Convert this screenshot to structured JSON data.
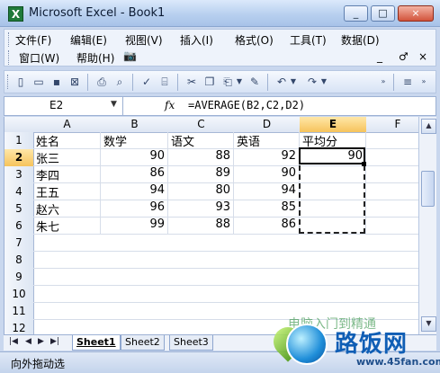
{
  "window": {
    "title": "Microsoft Excel - Book1",
    "controls": [
      "_",
      "□",
      "×"
    ]
  },
  "menu": {
    "row1": [
      "文件(F)",
      "编辑(E)",
      "视图(V)",
      "插入(I)",
      "格式(O)",
      "工具(T)",
      "数据(D)"
    ],
    "row2": [
      "窗口(W)",
      "帮助(H)"
    ],
    "right": [
      "_",
      "♂",
      "×"
    ]
  },
  "formula_bar": {
    "name_box": "E2",
    "fx_label": "fx",
    "formula": "=AVERAGE(B2,C2,D2)"
  },
  "columns": [
    "A",
    "B",
    "C",
    "D",
    "E",
    "F"
  ],
  "rows": [
    "1",
    "2",
    "3",
    "4",
    "5",
    "6",
    "7",
    "8",
    "9",
    "10",
    "11",
    "12"
  ],
  "table": {
    "header": [
      "姓名",
      "数学",
      "语文",
      "英语",
      "平均分"
    ],
    "data": [
      [
        "张三",
        "90",
        "88",
        "92",
        "90"
      ],
      [
        "李四",
        "86",
        "89",
        "90",
        ""
      ],
      [
        "王五",
        "94",
        "80",
        "94",
        ""
      ],
      [
        "赵六",
        "96",
        "93",
        "85",
        ""
      ],
      [
        "朱七",
        "99",
        "88",
        "86",
        ""
      ]
    ]
  },
  "sheets": [
    "Sheet1",
    "Sheet2",
    "Sheet3"
  ],
  "active_sheet": "Sheet1",
  "status": "向外拖动选",
  "watermark": {
    "brand": "路饭网",
    "url": "www.45fan.com",
    "faint": "电脑入门到精通"
  },
  "colors": {
    "accent": "#1f7a3a",
    "title_gradient_top": "#dbe9fb",
    "active_header": "#f6c35c"
  }
}
